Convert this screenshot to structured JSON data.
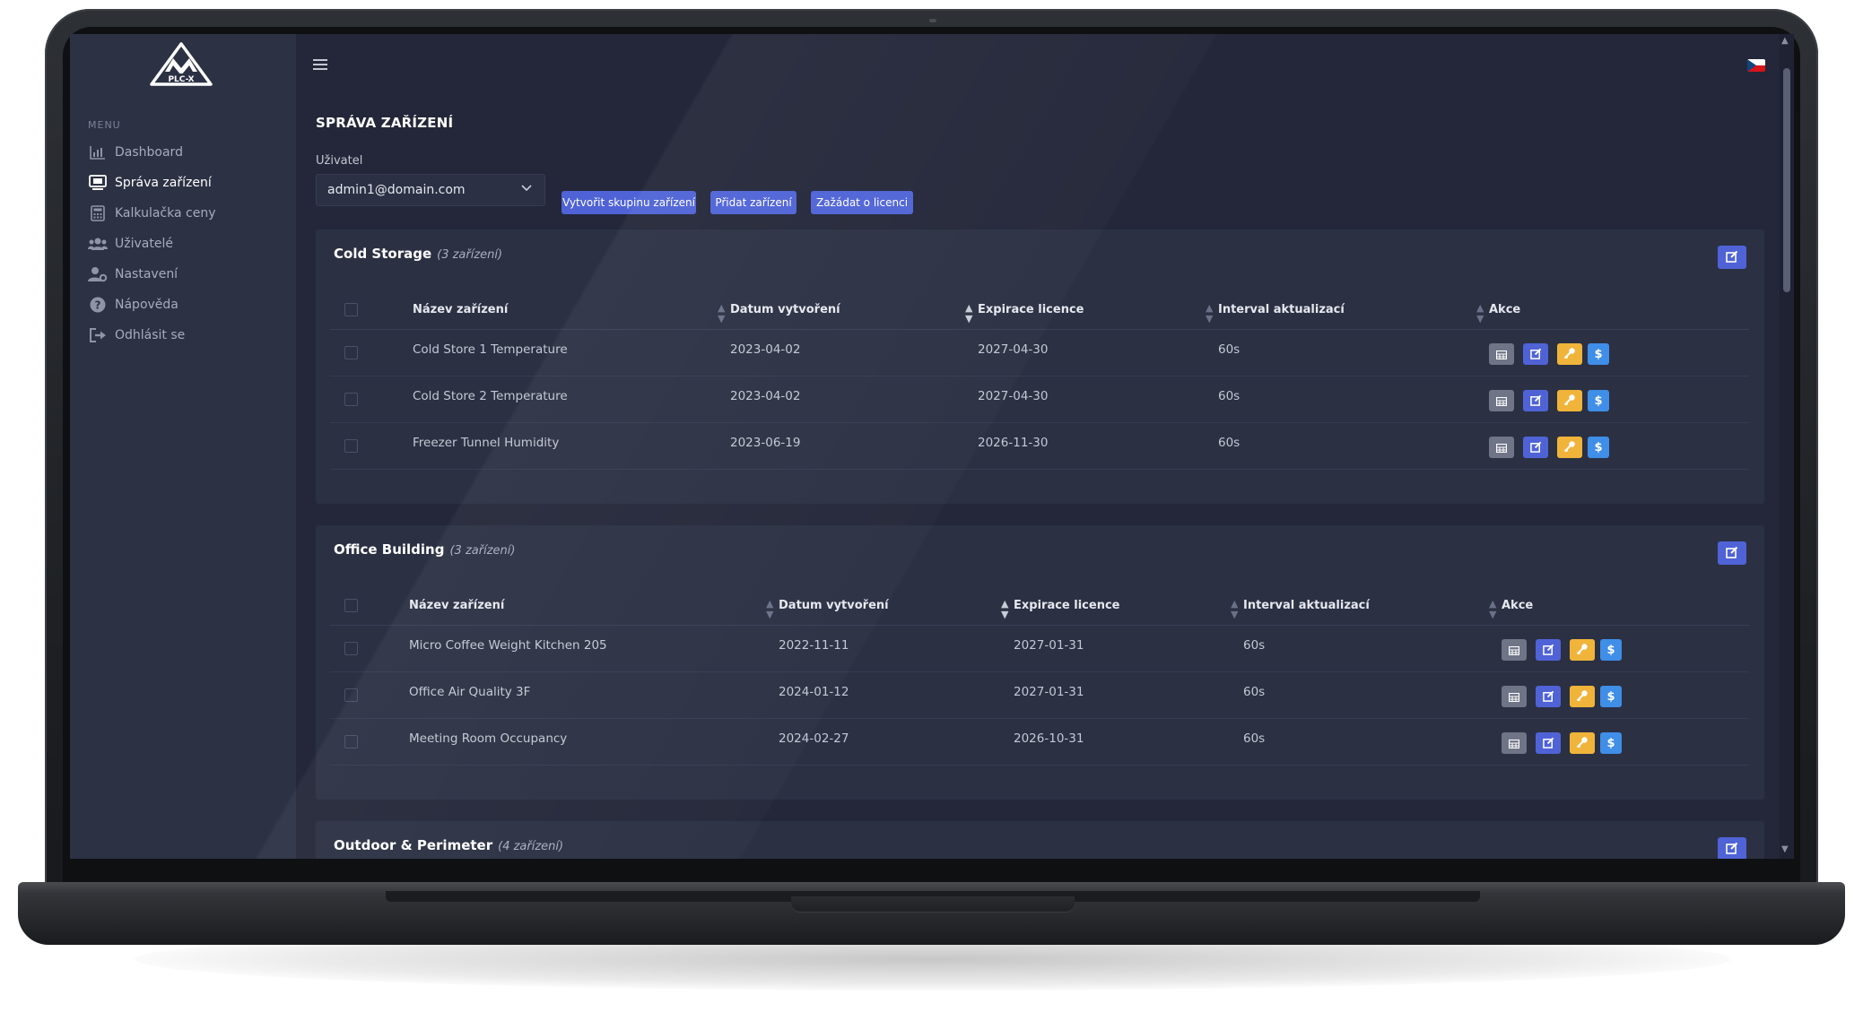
{
  "brand": {
    "logo_text": "PLC-X"
  },
  "sidebar": {
    "menu_label": "MENU",
    "items": [
      {
        "label": "Dashboard",
        "icon": "chart-icon"
      },
      {
        "label": "Správa zařízení",
        "icon": "device-icon",
        "active": true
      },
      {
        "label": "Kalkulačka ceny",
        "icon": "calculator-icon"
      },
      {
        "label": "Uživatelé",
        "icon": "users-icon"
      },
      {
        "label": "Nastavení",
        "icon": "user-gear-icon"
      },
      {
        "label": "Nápověda",
        "icon": "help-icon"
      },
      {
        "label": "Odhlásit se",
        "icon": "logout-icon"
      }
    ]
  },
  "topbar": {
    "language": "CZ"
  },
  "page": {
    "title": "SPRÁVA ZAŘÍZENÍ",
    "user_label": "Uživatel",
    "user_value": "admin1@domain.com",
    "buttons": {
      "create_group": "Vytvořit skupinu zařízení",
      "add_device": "Přidat zařízení",
      "request_license": "Zažádat o licenci"
    }
  },
  "table_headers": {
    "name": "Název zařízení",
    "created": "Datum vytvoření",
    "expiry": "Expirace licence",
    "interval": "Interval aktualizací",
    "actions": "Akce"
  },
  "groups": [
    {
      "name": "Cold Storage",
      "count": "(3 zařízení)",
      "rows": [
        {
          "name": "Cold Store 1 Temperature",
          "created": "2023-04-02",
          "expiry": "2027-04-30",
          "interval": "60s"
        },
        {
          "name": "Cold Store 2 Temperature",
          "created": "2023-04-02",
          "expiry": "2027-04-30",
          "interval": "60s"
        },
        {
          "name": "Freezer Tunnel Humidity",
          "created": "2023-06-19",
          "expiry": "2026-11-30",
          "interval": "60s"
        }
      ]
    },
    {
      "name": "Office Building",
      "count": "(3 zařízení)",
      "rows": [
        {
          "name": "Micro Coffee Weight Kitchen 205",
          "created": "2022-11-11",
          "expiry": "2027-01-31",
          "interval": "60s"
        },
        {
          "name": "Office Air Quality 3F",
          "created": "2024-01-12",
          "expiry": "2027-01-31",
          "interval": "60s"
        },
        {
          "name": "Meeting Room Occupancy",
          "created": "2024-02-27",
          "expiry": "2026-10-31",
          "interval": "60s"
        }
      ]
    },
    {
      "name": "Outdoor & Perimeter",
      "count": "(4 zařízení)",
      "rows": []
    }
  ],
  "action_icons": [
    "table-icon",
    "edit-icon",
    "key-icon",
    "dollar-icon"
  ],
  "action_labels": {
    "license_price": "$"
  },
  "colors": {
    "accent": "#4f63d6",
    "warning": "#f0b43a",
    "info": "#3f8ee8",
    "neutral": "#6f7487",
    "sidebar_bg": "#2c3144",
    "content_bg": "#232739",
    "card_bg": "#2b3043"
  }
}
